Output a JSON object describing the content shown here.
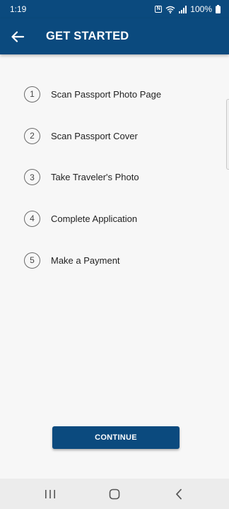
{
  "status": {
    "time": "1:19",
    "nfc_label": "N",
    "battery": "100%"
  },
  "header": {
    "title": "GET STARTED"
  },
  "steps": [
    {
      "number": "1",
      "label": "Scan Passport Photo Page"
    },
    {
      "number": "2",
      "label": "Scan Passport Cover"
    },
    {
      "number": "3",
      "label": "Take Traveler's Photo"
    },
    {
      "number": "4",
      "label": "Complete Application"
    },
    {
      "number": "5",
      "label": "Make a Payment"
    }
  ],
  "continue_label": "CONTINUE",
  "colors": {
    "brand": "#0b4a7e",
    "background": "#f7f7f7",
    "nav_bar": "#ececec"
  },
  "icons": {
    "back": "arrow-left-icon",
    "recent_apps": "recent-apps-icon",
    "home": "home-icon",
    "nav_back": "chevron-left-icon"
  }
}
